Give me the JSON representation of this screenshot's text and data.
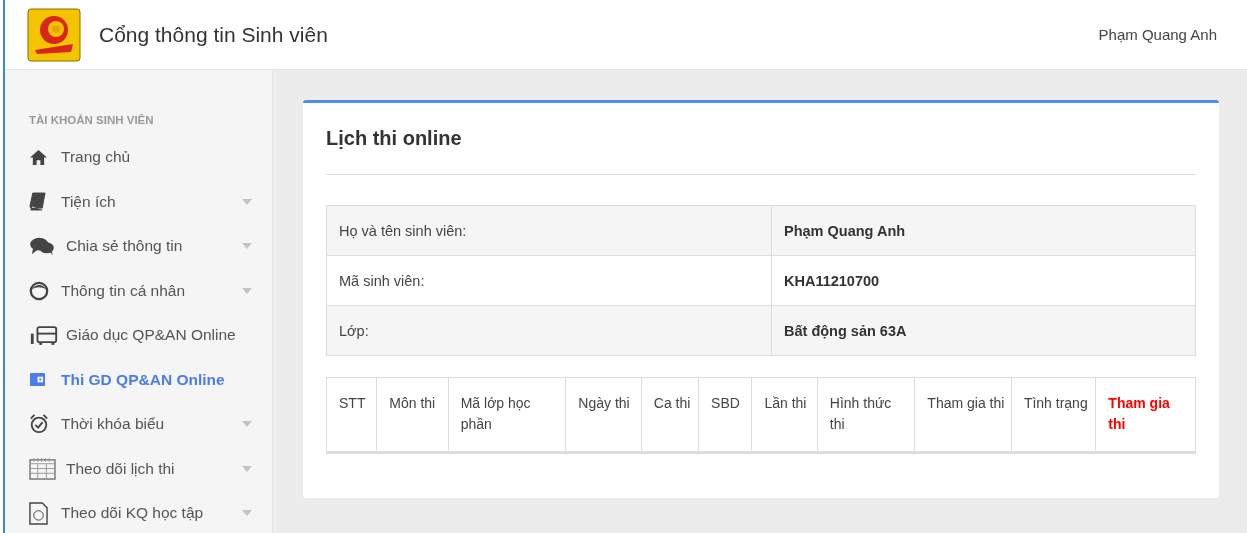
{
  "header": {
    "title": "Cổng thông tin Sinh viên",
    "user": "Phạm Quang Anh"
  },
  "sidebar": {
    "heading": "TÀI KHOẢN SINH VIÊN",
    "items": [
      {
        "label": "Trang chủ",
        "selected": false,
        "expandable": false
      },
      {
        "label": "Tiện ích",
        "selected": false,
        "expandable": true
      },
      {
        "label": "Chia sẻ thông tin",
        "selected": false,
        "expandable": true
      },
      {
        "label": "Thông tin cá nhân",
        "selected": false,
        "expandable": true
      },
      {
        "label": "Giáo dục QP&AN Online",
        "selected": false,
        "expandable": false
      },
      {
        "label": "Thi GD QP&AN Online",
        "selected": true,
        "expandable": false
      },
      {
        "label": "Thời khóa biểu",
        "selected": false,
        "expandable": true
      },
      {
        "label": "Theo dõi lịch thi",
        "selected": false,
        "expandable": true
      },
      {
        "label": "Theo dõi KQ học tập",
        "selected": false,
        "expandable": true
      }
    ]
  },
  "card": {
    "title": "Lịch thi online",
    "info": [
      {
        "label": "Họ và tên sinh viên:",
        "value": "Phạm Quang Anh"
      },
      {
        "label": "Mã sinh viên:",
        "value": "KHA11210700"
      },
      {
        "label": "Lớp:",
        "value": "Bất động sản 63A"
      }
    ],
    "table": {
      "columns": [
        {
          "label": "STT",
          "emphasis": false
        },
        {
          "label": "Môn thi",
          "emphasis": false
        },
        {
          "label": "Mã lớp học phần",
          "emphasis": false
        },
        {
          "label": "Ngày thi",
          "emphasis": false
        },
        {
          "label": "Ca thi",
          "emphasis": false
        },
        {
          "label": "SBD",
          "emphasis": false
        },
        {
          "label": "Lần thi",
          "emphasis": false
        },
        {
          "label": "Hình thức thi",
          "emphasis": false
        },
        {
          "label": "Tham gia thi",
          "emphasis": false
        },
        {
          "label": "Tình trạng",
          "emphasis": false
        },
        {
          "label": "Tham gia thi",
          "emphasis": true
        }
      ]
    }
  }
}
